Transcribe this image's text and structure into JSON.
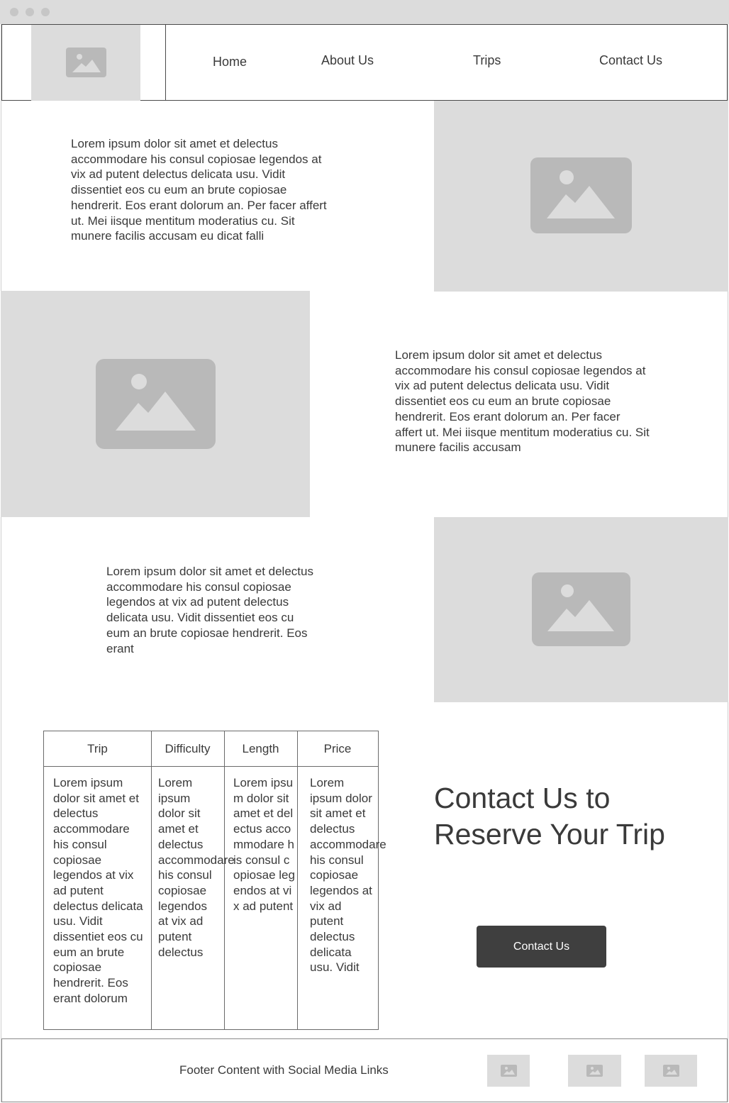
{
  "nav": {
    "items": [
      {
        "label": "Home"
      },
      {
        "label": "About Us"
      },
      {
        "label": "Trips"
      },
      {
        "label": "Contact Us"
      }
    ]
  },
  "sections": [
    {
      "text": "Lorem ipsum dolor sit amet et delectus accommodare his consul copiosae legendos at vix ad putent delectus delicata usu. Vidit dissentiet eos cu eum an brute copiosae hendrerit. Eos erant dolorum an. Per facer affert ut. Mei iisque mentitum moderatius cu. Sit munere facilis accusam eu dicat falli"
    },
    {
      "text": "Lorem ipsum dolor sit amet et delectus accommodare his consul copiosae legendos at vix ad putent delectus delicata usu. Vidit dissentiet eos cu eum an brute copiosae hendrerit. Eos erant dolorum an. Per facer affert ut. Mei iisque mentitum moderatius cu. Sit munere facilis accusam"
    },
    {
      "text": "Lorem ipsum dolor sit amet et delectus accommodare his consul copiosae legendos at vix ad putent delectus delicata usu. Vidit dissentiet eos cu eum an brute copiosae hendrerit. Eos erant"
    }
  ],
  "table": {
    "headers": [
      "Trip",
      "Difficulty",
      "Length",
      "Price"
    ],
    "cells": [
      "Lorem ipsum dolor sit amet et delectus accommodare his consul copiosae legendos at vix ad putent delectus delicata usu. Vidit dissentiet eos cu eum an brute copiosae hendrerit. Eos erant dolorum",
      "Lorem ipsum dolor sit amet et delectus accommodare his consul copiosae legendos at vix ad putent delectus",
      "Lorem ipsum dolor sit amet et delectus accommodare his consul copiosae legendos at vix ad putent",
      "Lorem ipsum dolor sit amet et delectus accommodare his consul copiosae legendos at vix ad putent delectus delicata usu. Vidit"
    ]
  },
  "cta": {
    "title": "Contact Us to Reserve Your Trip",
    "button_label": "Contact Us"
  },
  "footer": {
    "text": "Footer Content with Social Media Links"
  },
  "colors": {
    "placeholder": "#dcdcdc",
    "placeholder_icon": "#b9b9b9",
    "button": "#3f3f3f"
  }
}
